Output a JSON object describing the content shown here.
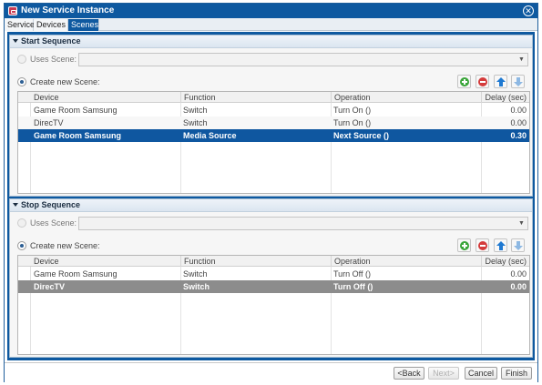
{
  "window": {
    "title": "New Service Instance",
    "close_glyph": "✕"
  },
  "tabs": [
    {
      "label": "Service",
      "active": false
    },
    {
      "label": "Devices",
      "active": false
    },
    {
      "label": "Scenes",
      "active": true
    }
  ],
  "start_sequence": {
    "header": "Start Sequence",
    "uses_scene_label": "Uses Scene:",
    "uses_scene_value": "",
    "create_new_label": "Create new Scene:",
    "columns": [
      "Device",
      "Function",
      "Operation",
      "Delay (sec)"
    ],
    "rows": [
      {
        "device": "Game Room Samsung",
        "function": "Switch",
        "operation": "Turn On ()",
        "delay": "0.00",
        "selected": false
      },
      {
        "device": "DirecTV",
        "function": "Switch",
        "operation": "Turn On ()",
        "delay": "0.00",
        "selected": false
      },
      {
        "device": "Game Room Samsung",
        "function": "Media Source",
        "operation": "Next Source ()",
        "delay": "0.30",
        "selected": true
      }
    ]
  },
  "stop_sequence": {
    "header": "Stop Sequence",
    "uses_scene_label": "Uses Scene:",
    "uses_scene_value": "",
    "create_new_label": "Create new Scene:",
    "columns": [
      "Device",
      "Function",
      "Operation",
      "Delay (sec)"
    ],
    "rows": [
      {
        "device": "Game Room Samsung",
        "function": "Switch",
        "operation": "Turn Off ()",
        "delay": "0.00",
        "selected": false
      },
      {
        "device": "DirecTV",
        "function": "Switch",
        "operation": "Turn Off ()",
        "delay": "0.00",
        "selected": true
      }
    ]
  },
  "icons": {
    "add": "add-icon",
    "remove": "remove-icon",
    "move_up": "arrow-up-icon",
    "move_down": "arrow-down-icon"
  },
  "footer": {
    "back_label": "<Back",
    "next_label": "Next>",
    "cancel_label": "Cancel",
    "finish_label": "Finish"
  },
  "colors": {
    "accent": "#0e59a0",
    "selection_blue": "#0f57a0",
    "selection_gray": "#8c8c8c"
  }
}
